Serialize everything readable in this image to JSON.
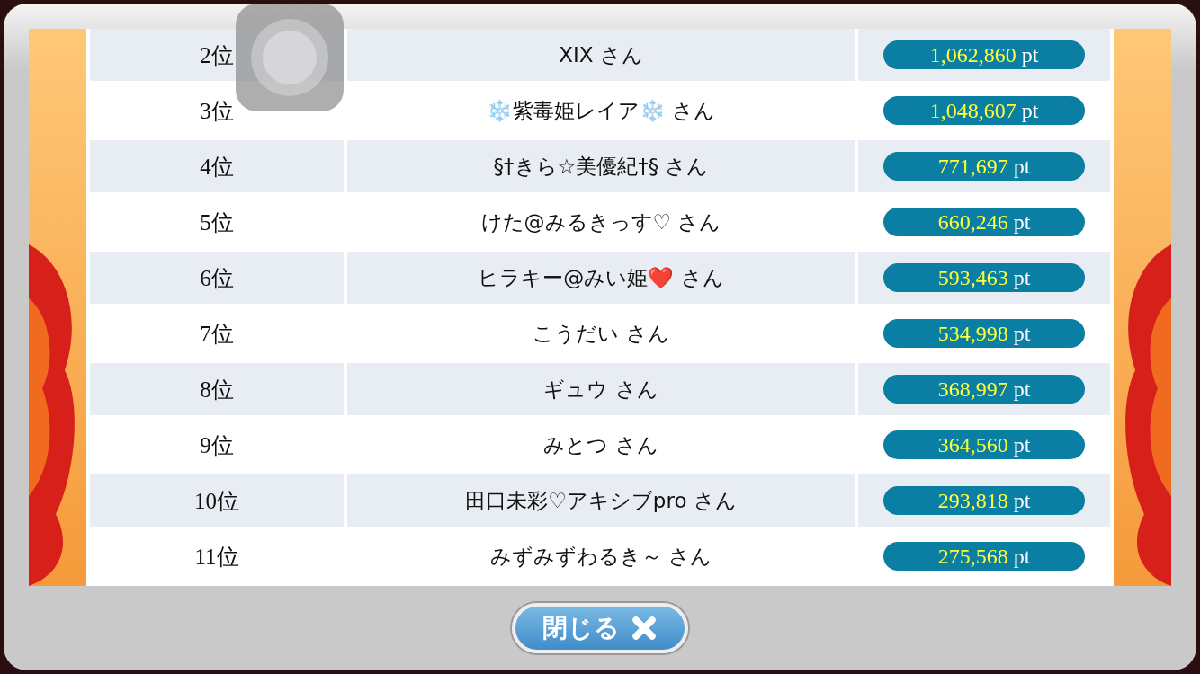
{
  "ranking": [
    {
      "rank": "2位",
      "name": "XIX さん",
      "points": "1,062,860",
      "unit": "pt"
    },
    {
      "rank": "3位",
      "name": "❄️紫毒姫レイア❄️ さん",
      "points": "1,048,607",
      "unit": "pt"
    },
    {
      "rank": "4位",
      "name": "§†きら☆美優紀†§ さん",
      "points": "771,697",
      "unit": "pt"
    },
    {
      "rank": "5位",
      "name": "けた@みるきっす♡ さん",
      "points": "660,246",
      "unit": "pt"
    },
    {
      "rank": "6位",
      "name": "ヒラキー@みい姫❤️ さん",
      "points": "593,463",
      "unit": "pt"
    },
    {
      "rank": "7位",
      "name": "こうだい さん",
      "points": "534,998",
      "unit": "pt"
    },
    {
      "rank": "8位",
      "name": "ギュウ さん",
      "points": "368,997",
      "unit": "pt"
    },
    {
      "rank": "9位",
      "name": "みとつ さん",
      "points": "364,560",
      "unit": "pt"
    },
    {
      "rank": "10位",
      "name": "田口未彩♡アキシブpro さん",
      "points": "293,818",
      "unit": "pt"
    },
    {
      "rank": "11位",
      "name": "みずみずわるき～ さん",
      "points": "275,568",
      "unit": "pt"
    }
  ],
  "close_button": {
    "label": "閉じる"
  }
}
